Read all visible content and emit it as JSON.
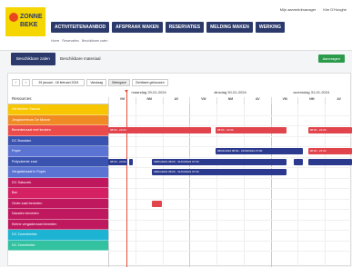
{
  "header": {
    "logo_line1": "ZONNE",
    "logo_line2": "BEKE",
    "user_links": [
      "Mijn aanmeldmanager",
      "Kim D'Hooghe"
    ],
    "nav": [
      "ACTIVITEITENAANBOD",
      "AFSPRAAK MAKEN",
      "RESERVATIES",
      "MELDING MAKEN",
      "WERKING"
    ]
  },
  "breadcrumb": [
    "Home",
    "Reservaties",
    "Beschikbare zalen"
  ],
  "tabs": {
    "active": "Beschikbare zalen",
    "other": "Beschikbare materiaal",
    "new_button": "Aanvragen"
  },
  "toolbar": {
    "prev": "‹",
    "next": "›",
    "date_range": "29 januari - 18 februari 2024",
    "today": "Vandaag",
    "period": "Weergave",
    "legend": "Zichtbare gebouwen"
  },
  "calendar": {
    "resources_header": "Resources",
    "days": [
      "maandag 29-01-2024",
      "dinsdag 30-01-2024",
      "woensdag 31-01-2024"
    ],
    "dayparts": [
      "VM",
      "NM",
      "AV",
      "VM",
      "NM",
      "AV",
      "VM",
      "NM",
      "AV"
    ],
    "resources": [
      {
        "label": "Vertrekken Sakura",
        "color": "#f7c600"
      },
      {
        "label": "Jeugdcentrum De Mosne",
        "color": "#f08a24"
      },
      {
        "label": "Benedenzaal met keuken",
        "color": "#ec4b4b"
      },
      {
        "label": "DC Bosstam",
        "color": "#3a53b0"
      },
      {
        "label": "Foyer",
        "color": "#5b74d4"
      },
      {
        "label": "Polyvalente zaal",
        "color": "#3a53b0"
      },
      {
        "label": "Vergaderzaal in Foyer",
        "color": "#5b74d4"
      },
      {
        "label": "DC Sakunek",
        "color": "#c0185e"
      },
      {
        "label": "Bar",
        "color": "#d62064"
      },
      {
        "label": "Grote zaal beneden",
        "color": "#c0185e"
      },
      {
        "label": "Nazalen beneden",
        "color": "#c0185e"
      },
      {
        "label": "Kleine vergaderzaal beneden",
        "color": "#c0185e"
      },
      {
        "label": "DC Zonnebeeke",
        "color": "#1db4d4"
      },
      {
        "label": "DC Zonnebeke",
        "color": "#32c2a0"
      }
    ],
    "events": [
      {
        "text": "08:00 - 22:00",
        "row": 2,
        "start": 0.0,
        "end": 0.42,
        "color": "red"
      },
      {
        "text": "08:00 - 22:00",
        "row": 2,
        "start": 0.44,
        "end": 0.73,
        "color": "red"
      },
      {
        "text": "08:00 - 22:00",
        "row": 2,
        "start": 0.82,
        "end": 1.0,
        "color": "red"
      },
      {
        "text": "08:00 - 22:00",
        "row": 4,
        "start": 0.82,
        "end": 1.0,
        "color": "red"
      },
      {
        "text": "08/01/2024 08:00 - 31/03/2024 07:00",
        "row": 4,
        "start": 0.44,
        "end": 0.8,
        "color": "blue"
      },
      {
        "text": "08:00 - 22:00",
        "row": 5,
        "start": 0.0,
        "end": 0.08,
        "color": "blue"
      },
      {
        "text": "",
        "row": 5,
        "start": 0.085,
        "end": 0.1,
        "color": "blue"
      },
      {
        "text": "08/01/2024 08:00 - 31/03/2024 07:00",
        "row": 5,
        "start": 0.18,
        "end": 0.73,
        "color": "blue"
      },
      {
        "text": "",
        "row": 5,
        "start": 0.76,
        "end": 0.8,
        "color": "blue"
      },
      {
        "text": "",
        "row": 5,
        "start": 0.82,
        "end": 1.0,
        "color": "blue"
      },
      {
        "text": "08/01/2024 08:00 - 31/03/2024 07:00",
        "row": 6,
        "start": 0.18,
        "end": 0.73,
        "color": "blue"
      },
      {
        "text": "",
        "row": 9,
        "start": 0.18,
        "end": 0.22,
        "color": "red"
      }
    ]
  }
}
